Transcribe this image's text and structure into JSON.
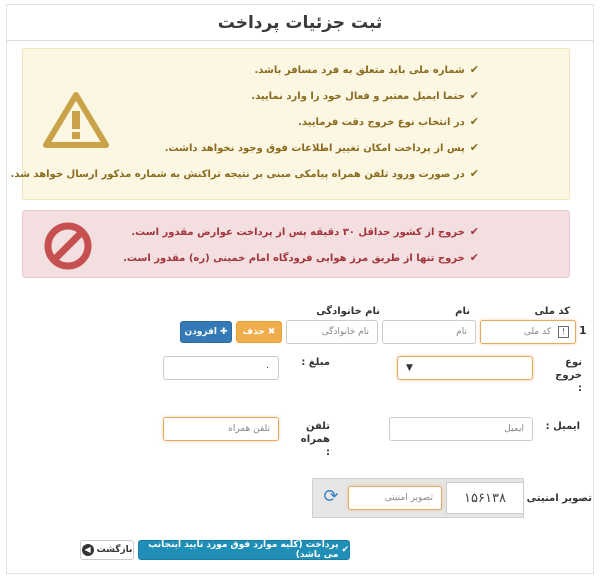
{
  "header": {
    "title": "ثبت جزئیات پرداخت"
  },
  "warning_panel": {
    "icon": "warning-triangle-icon",
    "items": [
      "شماره ملی باید متعلق به فرد مسافر باشد.",
      "حتما ایمیل معتبر و فعال خود را وارد نمایید.",
      "در انتخاب نوع خروج دقت فرمایید.",
      "پس از پرداخت امکان تغییر اطلاعات فوق وجود نخواهد داشت.",
      "در صورت ورود تلفن همراه پیامکی مبنی بر نتیجه تراکنش به شماره مذکور ارسال خواهد شد."
    ]
  },
  "danger_panel": {
    "icon": "prohibited-icon",
    "items": [
      "خروج از کشور حداقل ۳۰ دقیقه پس از پرداخت عوارض مقدور است.",
      "خروج تنها از طریق مرز هوایی فرودگاه امام خمینی (ره) مقدور است."
    ]
  },
  "passenger": {
    "row_number": "1",
    "national_code_label": "کد ملی",
    "national_code_placeholder": "کد ملی",
    "first_name_label": "نام",
    "first_name_placeholder": "نام",
    "last_name_label": "نام خانوادگی",
    "last_name_placeholder": "نام خانوادگی",
    "delete_label": "حذف",
    "add_label": "افزودن"
  },
  "exit_type": {
    "label": "نوع خروج :",
    "value": ""
  },
  "amount": {
    "label": "مبلغ :",
    "value": "۰"
  },
  "email": {
    "label": "ایمیل :",
    "placeholder": "ایمیل"
  },
  "mobile": {
    "label": "تلفن همراه :",
    "placeholder": "تلفن همراه"
  },
  "captcha": {
    "label": "تصویر امنیتی :",
    "placeholder": "تصویر امنیتی",
    "image_text": "۱۵۶۱۳۸"
  },
  "actions": {
    "pay_label": "پرداخت (کلیه موارد فوق مورد تایید اینجانب می باشد)",
    "back_label": "بازگشت"
  },
  "colors": {
    "warning_bg": "#fcf7e2",
    "danger_bg": "#f3dfe0",
    "primary": "#337ab7",
    "orange": "#f0ad4e",
    "teal": "#1f8fb8",
    "warning_icon": "#c9a24a",
    "danger_icon": "#c5504f"
  }
}
